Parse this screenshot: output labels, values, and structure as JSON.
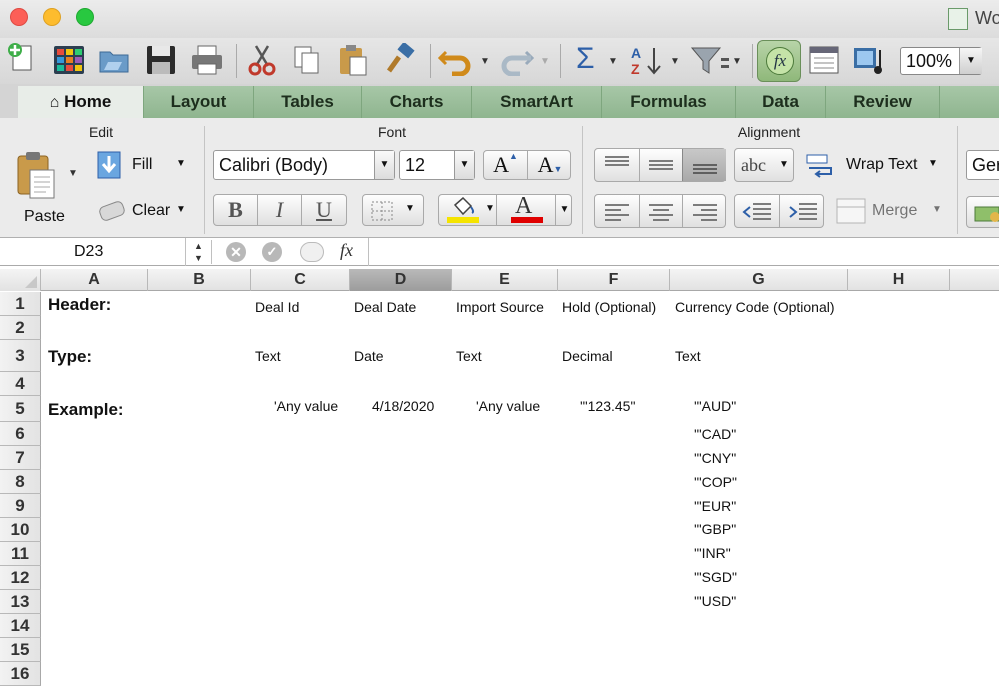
{
  "window": {
    "title": "Wo"
  },
  "toolbar": {
    "zoom": "100%",
    "icons": [
      "new-icon",
      "gallery-icon",
      "open-icon",
      "save-icon",
      "print-icon",
      "cut-icon",
      "copy-icon",
      "paste-icon",
      "format-painter-icon",
      "undo-icon",
      "redo-icon",
      "autosum-icon",
      "sort-icon",
      "filter-icon",
      "formula-builder-icon",
      "toolbox-icon",
      "media-icon"
    ]
  },
  "tabs": [
    "Home",
    "Layout",
    "Tables",
    "Charts",
    "SmartArt",
    "Formulas",
    "Data",
    "Review"
  ],
  "ribbon": {
    "groups": {
      "edit": "Edit",
      "font": "Font",
      "alignment": "Alignment"
    },
    "paste_label": "Paste",
    "fill_label": "Fill",
    "clear_label": "Clear",
    "font_name": "Calibri (Body)",
    "font_size": "12",
    "grow_label": "A",
    "shrink_label": "A",
    "bold": "B",
    "italic": "I",
    "underline": "U",
    "font_color_label": "A",
    "orientation_label": "abc",
    "wrap_text": "Wrap Text",
    "merge": "Merge",
    "number_format": "Ger",
    "highlight_color": "#f5e400",
    "font_color": "#e00000"
  },
  "formula_bar": {
    "name_box": "D23",
    "fx": "fx",
    "value": ""
  },
  "sheet": {
    "columns": [
      "A",
      "B",
      "C",
      "D",
      "E",
      "F",
      "G",
      "H"
    ],
    "selected_column": "D",
    "rows": [
      "1",
      "2",
      "3",
      "4",
      "5",
      "6",
      "7",
      "8",
      "9",
      "10",
      "11",
      "12",
      "13",
      "14",
      "15",
      "16"
    ],
    "row1": {
      "a": "Header:",
      "c": "Deal Id",
      "d": "Deal Date",
      "e": "Import Source",
      "f": "Hold (Optional)",
      "g": "Currency Code (Optional)"
    },
    "row3": {
      "a": "Type:",
      "c": "Text",
      "d": "Date",
      "e": "Text",
      "f": "Decimal",
      "g": "Text"
    },
    "row5": {
      "a": "Example:",
      "c": "'Any value",
      "d": "4/18/2020",
      "e": "'Any value",
      "f": "'\"123.45\"",
      "g": "'\"AUD\""
    },
    "currencies": [
      "'\"CAD\"",
      "'\"CNY\"",
      "'\"COP\"",
      "'\"EUR\"",
      "'\"GBP\"",
      "'\"INR\"",
      "'\"SGD\"",
      "'\"USD\""
    ]
  }
}
